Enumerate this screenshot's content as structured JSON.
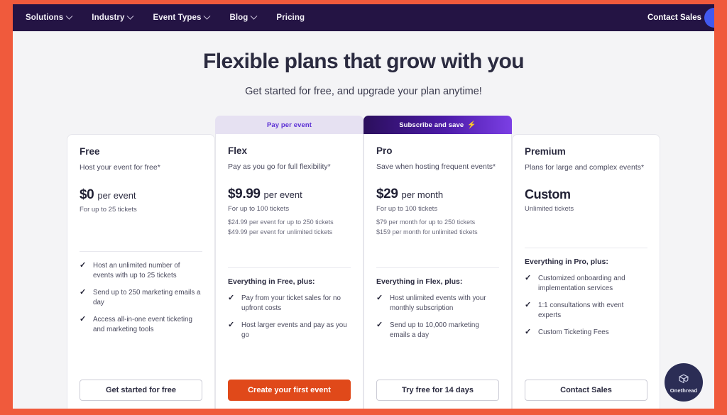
{
  "nav": {
    "items": [
      {
        "label": "Solutions",
        "has_chevron": true
      },
      {
        "label": "Industry",
        "has_chevron": true
      },
      {
        "label": "Event Types",
        "has_chevron": true
      },
      {
        "label": "Blog",
        "has_chevron": true
      },
      {
        "label": "Pricing",
        "has_chevron": false
      }
    ],
    "contact_sales": "Contact Sales",
    "bar_color": "#241444",
    "orb_color": "#4259f0"
  },
  "hero": {
    "title": "Flexible plans that grow with you",
    "subtitle": "Get started for free, and upgrade your plan anytime!"
  },
  "plans": [
    {
      "badge": null,
      "name": "Free",
      "tagline": "Host your event for free*",
      "price_amount": "$0",
      "price_unit": "per event",
      "price_note": "For up to 25 tickets",
      "price_extra": [],
      "features_title": "",
      "features": [
        "Host an unlimited number of events with up to 25 tickets",
        "Send up to 250 marketing emails a day",
        "Access all-in-one event ticketing and marketing tools"
      ],
      "cta_label": "Get started for free",
      "cta_style": "outline"
    },
    {
      "badge": {
        "label": "Pay per event",
        "icon": null,
        "style": "flex-badge"
      },
      "name": "Flex",
      "tagline": "Pay as you go for full flexibility*",
      "price_amount": "$9.99",
      "price_unit": "per event",
      "price_note": "For up to 100 tickets",
      "price_extra": [
        "$24.99 per event for up to 250 tickets",
        "$49.99 per event for unlimited tickets"
      ],
      "features_title": "Everything in Free, plus:",
      "features": [
        "Pay from your ticket sales for no upfront costs",
        "Host larger events and pay as you go"
      ],
      "cta_label": "Create your first event",
      "cta_style": "solid"
    },
    {
      "badge": {
        "label": "Subscribe and save",
        "icon": "⚡",
        "style": "pro-badge"
      },
      "name": "Pro",
      "tagline": "Save when hosting frequent events*",
      "price_amount": "$29",
      "price_unit": "per month",
      "price_note": "For up to 100 tickets",
      "price_extra": [
        "$79 per month for up to 250 tickets",
        "$159 per month for unlimited tickets"
      ],
      "features_title": "Everything in Flex, plus:",
      "features": [
        "Host unlimited events with your monthly subscription",
        "Send up to 10,000 marketing emails a day"
      ],
      "cta_label": "Try free for 14 days",
      "cta_style": "outline"
    },
    {
      "badge": null,
      "name": "Premium",
      "tagline": "Plans for large and complex events*",
      "price_amount": "Custom",
      "price_unit": "",
      "price_note": "Unlimited tickets",
      "price_extra": [],
      "features_title": "Everything in Pro, plus:",
      "features": [
        "Customized onboarding and implementation services",
        "1:1 consultations with event experts",
        "Custom Ticketing Fees"
      ],
      "cta_label": "Contact Sales",
      "cta_style": "outline"
    }
  ],
  "chat_widget": {
    "label": "Onethread",
    "background": "#2b2d55"
  },
  "theme": {
    "page_border": "#f05a3c",
    "page_background": "#f4f4f6",
    "cta_solid": "#e0491a"
  }
}
